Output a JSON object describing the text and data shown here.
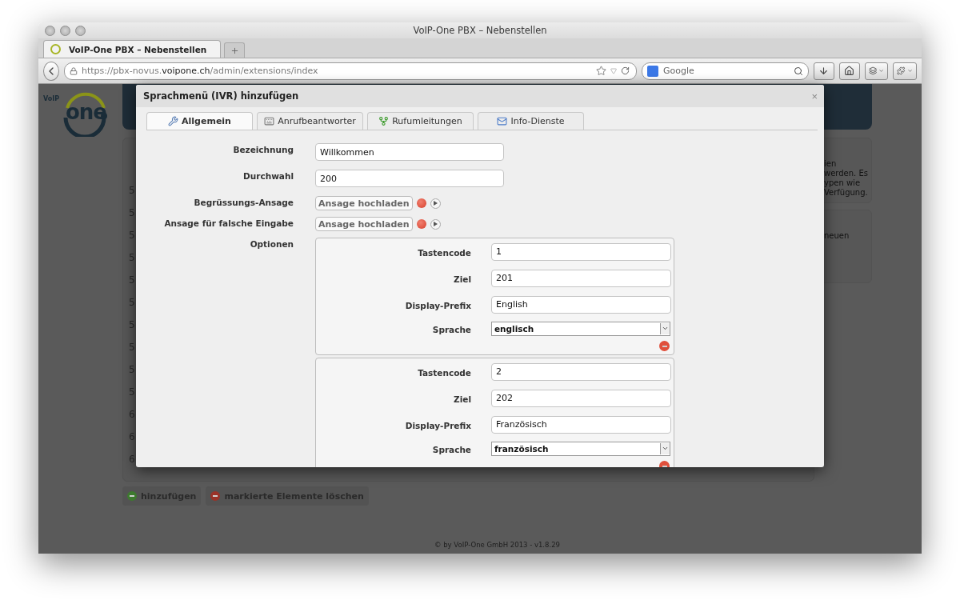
{
  "window": {
    "title": "VoIP-One PBX – Nebenstellen"
  },
  "browser_tabs": [
    {
      "title": "VoIP-One PBX – Nebenstellen",
      "selected": true
    }
  ],
  "address_bar": {
    "url": "https://pbx-novus.**voipone.ch**/admin/extensions/index"
  },
  "search": {
    "placeholder": "Google"
  },
  "page": {
    "logo": {
      "small": "VoIP",
      "large": "one"
    },
    "table_rows": [
      "5",
      "5",
      "5",
      "5",
      "5",
      "5",
      "5",
      "5",
      "5",
      "5",
      "6",
      "6",
      "6"
    ],
    "side_panels": [
      {
        "lines": [
          "ien",
          "werden. Es",
          "ypen wie",
          "Verfügung."
        ]
      },
      {
        "lines": [
          "neuen"
        ]
      }
    ],
    "actions": [
      {
        "kind": "add",
        "label": "hinzufügen"
      },
      {
        "kind": "delete",
        "label": "markierte Elemente löschen"
      }
    ],
    "footer": "© by VoIP-One GmbH 2013 - v1.8.29"
  },
  "dialog": {
    "title": "Sprachmenü (IVR) hinzufügen",
    "close": "×",
    "tabs": [
      {
        "label": "Allgemein",
        "selected": true
      },
      {
        "label": "Anrufbeantworter",
        "selected": false
      },
      {
        "label": "Rufumleitungen",
        "selected": false
      },
      {
        "label": "Info-Dienste",
        "selected": false
      }
    ],
    "fields": [
      {
        "kind": "text",
        "label": "Bezeichnung",
        "value": "Willkommen"
      },
      {
        "kind": "text",
        "label": "Durchwahl",
        "value": "200"
      },
      {
        "kind": "upload",
        "label": "Begrüssungs-Ansage",
        "button": "Ansage hochladen"
      },
      {
        "kind": "upload",
        "label": "Ansage für falsche Eingabe",
        "button": "Ansage hochladen"
      }
    ],
    "options_label": "Optionen",
    "options": [
      {
        "fields": [
          {
            "kind": "text",
            "label": "Tastencode",
            "value": "1"
          },
          {
            "kind": "text",
            "label": "Ziel",
            "value": "201"
          },
          {
            "kind": "text",
            "label": "Display-Prefix",
            "value": "English"
          },
          {
            "kind": "select",
            "label": "Sprache",
            "value": "englisch"
          }
        ]
      },
      {
        "fields": [
          {
            "kind": "text",
            "label": "Tastencode",
            "value": "2"
          },
          {
            "kind": "text",
            "label": "Ziel",
            "value": "202"
          },
          {
            "kind": "text",
            "label": "Display-Prefix",
            "value": "Französisch"
          },
          {
            "kind": "select",
            "label": "Sprache",
            "value": "französisch"
          }
        ]
      }
    ]
  }
}
